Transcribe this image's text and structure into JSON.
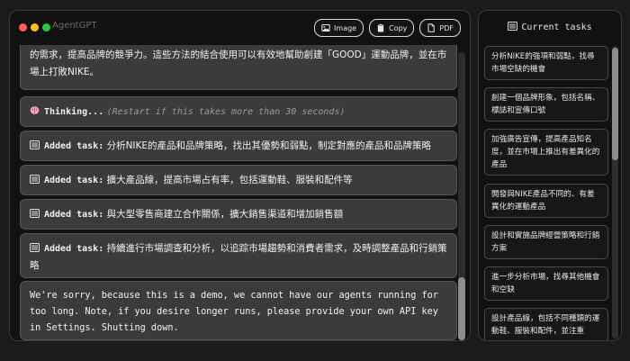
{
  "app": {
    "title": "AgentGPT"
  },
  "window_dots": [
    "#ff5f56",
    "#ffbd2e",
    "#27c93f"
  ],
  "toolbar": {
    "image_label": "Image",
    "copy_label": "Copy",
    "pdf_label": "PDF"
  },
  "feed": {
    "partial_text": "的需求，提高品牌的競爭力。這些方法的結合使用可以有效地幫助創建「GOOD」運動品牌，並在市場上打敗NIKE。",
    "thinking": {
      "label": "Thinking...",
      "hint": "(Restart if this takes more than 30 seconds)",
      "icon": "brain-icon"
    },
    "added_label": "Added task:",
    "tasks": [
      "分析NIKE的產品和品牌策略，找出其優勢和弱點，制定對應的產品和品牌策略",
      "擴大產品線，提高市場占有率，包括運動鞋、服裝和配件等",
      "與大型零售商建立合作關係，擴大銷售渠道和增加銷售額",
      "持續進行市場調查和分析，以追踪市場趨勢和消費者需求，及時調整產品和行銷策略"
    ],
    "shutdown_message": "We're sorry, because this is a demo, we cannot have our agents running for too long. Note, if you desire longer runs, please provide your own API key in Settings. Shutting down."
  },
  "sidebar": {
    "title": "Current tasks",
    "tasks": [
      "分析NIKE的強項和弱點，找尋市場空缺的機會",
      "創建一個品牌形象，包括名稱、標誌和宣傳口號",
      "加強廣告宣傳，提高產品知名度，並在市場上推出有差異化的產品",
      "開發與NIKE產品不同的、有差異化的運動產品",
      "設計和實施品牌經營策略和行銷方案",
      "進一步分析市場，找尋其他機會和空缺",
      "設計產品線，包括不同種類的運動鞋、服裝和配件，並注重"
    ]
  }
}
